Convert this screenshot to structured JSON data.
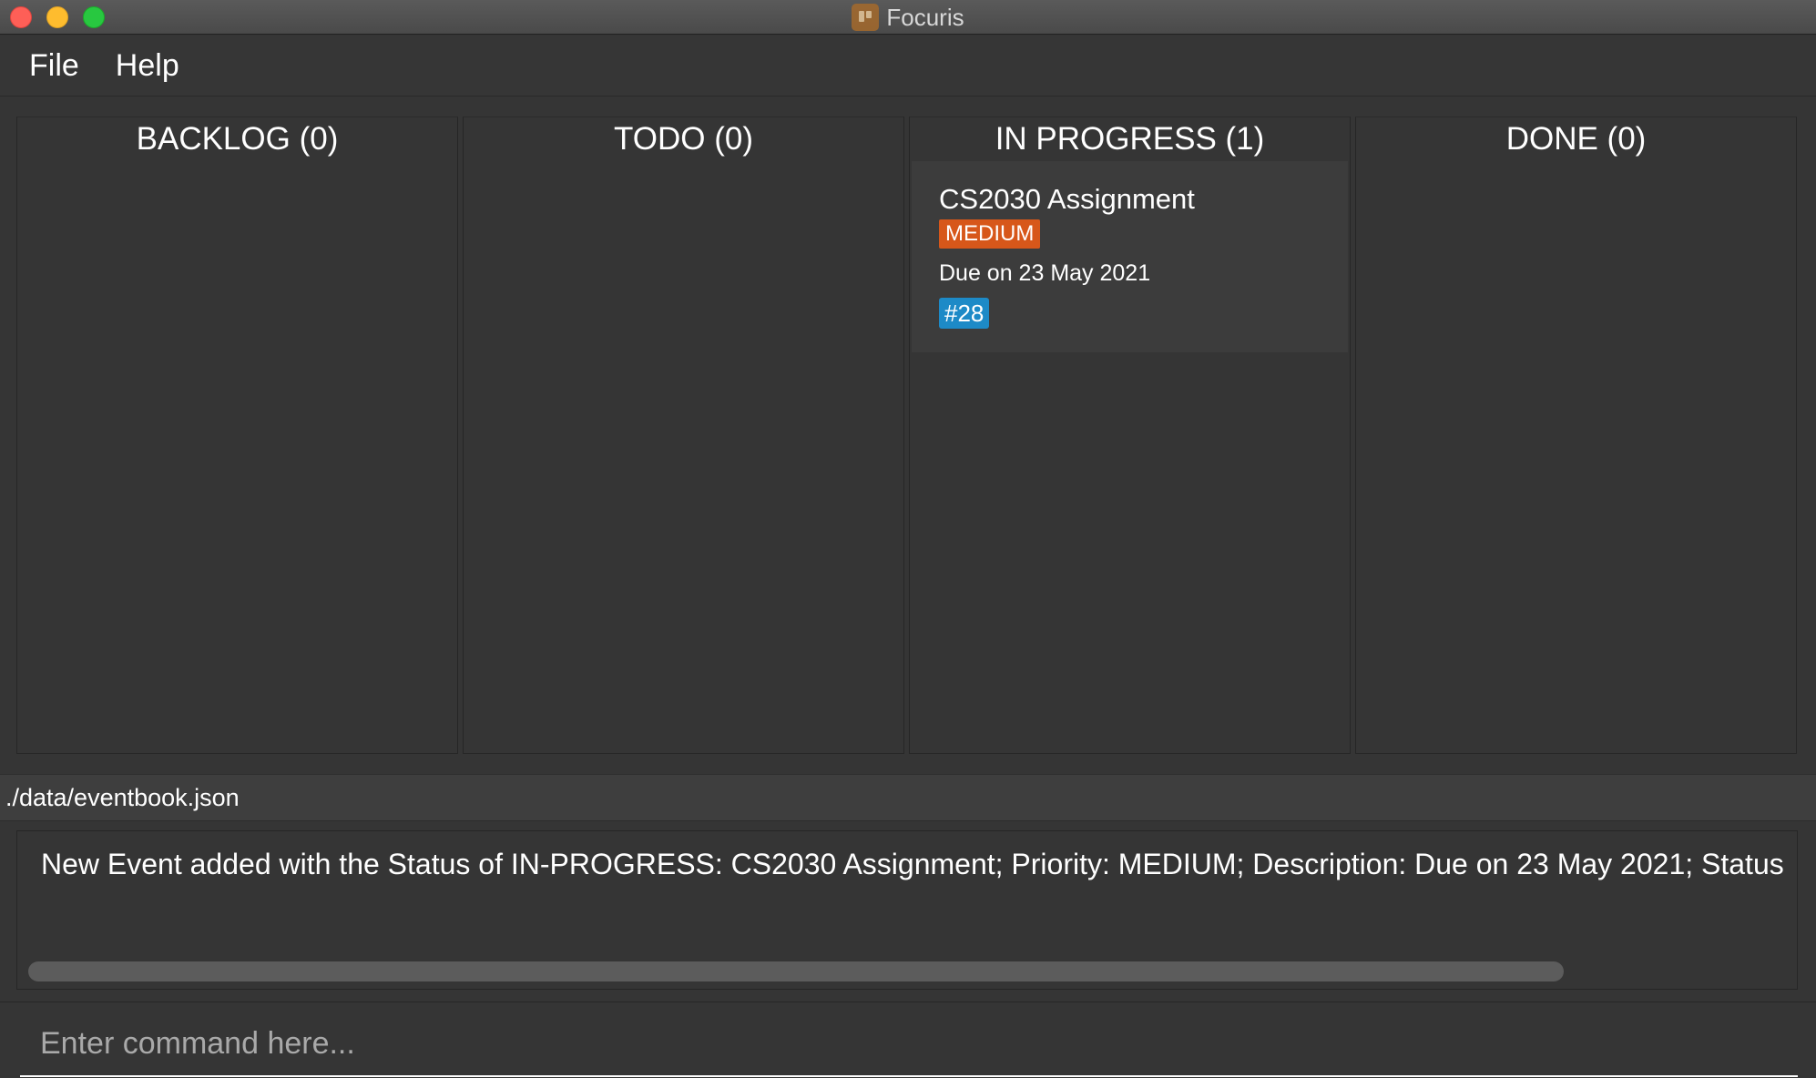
{
  "window": {
    "title": "Focuris",
    "icon": "kanban-board-icon"
  },
  "menu": {
    "items": [
      "File",
      "Help"
    ]
  },
  "board": {
    "columns": [
      {
        "header": "BACKLOG (0)",
        "cards": []
      },
      {
        "header": "TODO (0)",
        "cards": []
      },
      {
        "header": "IN PROGRESS (1)",
        "cards": [
          {
            "title": "CS2030 Assignment",
            "priority": "MEDIUM",
            "description": "Due on 23 May 2021",
            "tag": "#28"
          }
        ]
      },
      {
        "header": "DONE (0)",
        "cards": []
      }
    ]
  },
  "status": {
    "file_path": "./data/eventbook.json"
  },
  "result": {
    "message": "New Event added with the Status of IN-PROGRESS: CS2030 Assignment; Priority: MEDIUM; Description: Due on 23 May 2021; Status"
  },
  "command": {
    "placeholder": "Enter command here..."
  },
  "colors": {
    "background": "#353535",
    "priority_medium": "#d7571a",
    "tag": "#1d8ac7"
  }
}
